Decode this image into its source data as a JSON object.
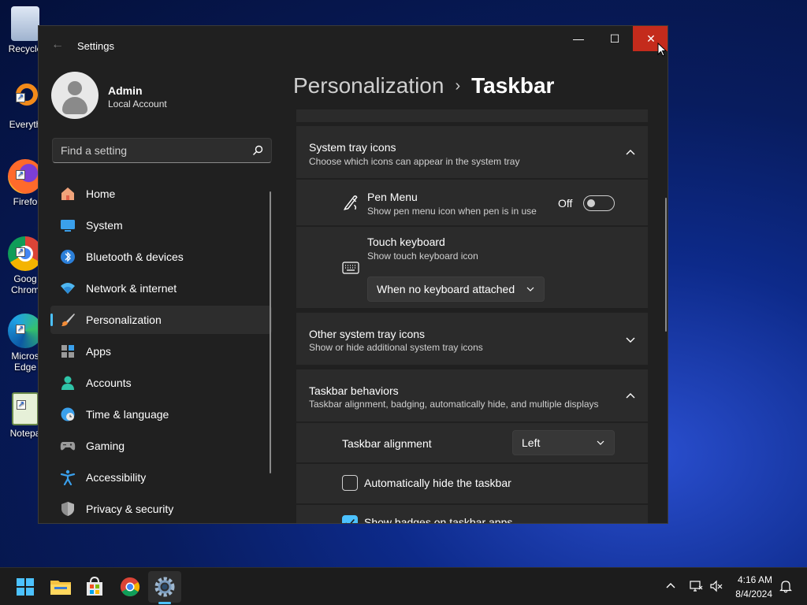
{
  "desktop": {
    "icons": [
      {
        "label": "Recycle"
      },
      {
        "label": "Everyth"
      },
      {
        "label": "Firefo"
      },
      {
        "label": "Goog Chrom"
      },
      {
        "label": "Micros Edge"
      },
      {
        "label": "Notepa"
      }
    ]
  },
  "window": {
    "title": "Settings",
    "controls": {
      "minimize": "—",
      "maximize": "☐",
      "close": "✕"
    },
    "back": "←"
  },
  "profile": {
    "name": "Admin",
    "account_type": "Local Account"
  },
  "search": {
    "placeholder": "Find a setting"
  },
  "nav": {
    "items": [
      {
        "label": "Home"
      },
      {
        "label": "System"
      },
      {
        "label": "Bluetooth & devices"
      },
      {
        "label": "Network & internet"
      },
      {
        "label": "Personalization"
      },
      {
        "label": "Apps"
      },
      {
        "label": "Accounts"
      },
      {
        "label": "Time & language"
      },
      {
        "label": "Gaming"
      },
      {
        "label": "Accessibility"
      },
      {
        "label": "Privacy & security"
      }
    ],
    "selected": "Personalization"
  },
  "breadcrumb": {
    "parent": "Personalization",
    "separator": "›",
    "current": "Taskbar"
  },
  "system_tray_icons": {
    "title": "System tray icons",
    "subtitle": "Choose which icons can appear in the system tray",
    "expanded": true,
    "pen_menu": {
      "title": "Pen Menu",
      "subtitle": "Show pen menu icon when pen is in use",
      "state_label": "Off",
      "on": false
    },
    "touch_keyboard": {
      "title": "Touch keyboard",
      "subtitle": "Show touch keyboard icon",
      "selected": "When no keyboard attached"
    }
  },
  "other_tray_icons": {
    "title": "Other system tray icons",
    "subtitle": "Show or hide additional system tray icons",
    "expanded": false
  },
  "taskbar_behaviors": {
    "title": "Taskbar behaviors",
    "subtitle": "Taskbar alignment, badging, automatically hide, and multiple displays",
    "expanded": true,
    "alignment": {
      "label": "Taskbar alignment",
      "selected": "Left"
    },
    "auto_hide": {
      "label": "Automatically hide the taskbar",
      "checked": false
    },
    "badges": {
      "label": "Show badges on taskbar apps",
      "checked": true
    }
  },
  "taskbar": {
    "apps": [
      "start-icon",
      "file-explorer-icon",
      "microsoft-store-icon",
      "chrome-icon",
      "settings-icon"
    ],
    "time": "4:16 AM",
    "date": "8/4/2024"
  },
  "colors": {
    "accent": "#4cc2ff",
    "close": "#c42b1c",
    "card": "#2b2b2b",
    "window": "#202020"
  }
}
